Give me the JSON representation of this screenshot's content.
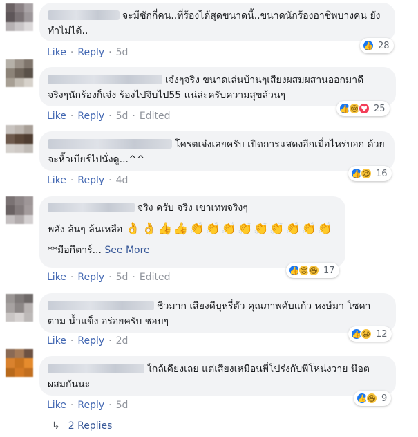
{
  "comments": [
    {
      "text": "จะมีซักกี่คน..ที่ร้องได้สุดขนาดนี้..ขนาดนักร้องอาชีพบางคน ยังทำไม่ได้..",
      "reaction_count": "28",
      "reactions": [
        "like-icon"
      ],
      "actions": {
        "like": "Like",
        "reply": "Reply",
        "time": "5d",
        "edited": ""
      },
      "avatar_colors": [
        "#6b6264",
        "#8a8184",
        "#a9a3a6",
        "#5e5659",
        "#7a7275",
        "#9d979a",
        "#b6b1b3",
        "#c9c5c7",
        "#dcd9da"
      ]
    },
    {
      "text": "เจ๋งๆจริง ขนาดเล่นบ้านๆเสียงผสมผสานออกมาดี จริงๆนักร้องก็เจ๋ง ร้องไปจิบไป55 แน่ล่ะครับความสุขล้วนๆ",
      "reaction_count": "25",
      "reactions": [
        "like-icon",
        "sad-icon",
        "love-icon"
      ],
      "actions": {
        "like": "Like",
        "reply": "Reply",
        "time": "5d",
        "edited": "Edited"
      },
      "avatar_colors": [
        "#b5b0a8",
        "#9a9188",
        "#7f756c",
        "#8c8378",
        "#6f655b",
        "#5a5149",
        "#a79f94",
        "#c3bdb4",
        "#d7d2cb"
      ]
    },
    {
      "text": "โครตเจ๋งเลยครับ เปิดการแสดงอีกเมื่อไหร่บอก ด้วย จะหิ้วเบียร์ไปนั่งดู...^^",
      "reaction_count": "16",
      "reactions": [
        "like-icon",
        "haha-icon"
      ],
      "actions": {
        "like": "Like",
        "reply": "Reply",
        "time": "4d",
        "edited": ""
      },
      "avatar_colors": [
        "#c8c3bf",
        "#bdb6b0",
        "#a89f97",
        "#6e5a4d",
        "#5b4739",
        "#4f3d31",
        "#d4d0cc",
        "#cfcac6",
        "#c1bcb7"
      ]
    },
    {
      "text": "จริง ครับ จริง เขาเทพจริงๆ",
      "text2": "พลัง ล้นๆ ล้นเหลือ",
      "emojis": [
        "👌",
        "👌",
        "👍",
        "👍",
        "👏",
        "👏",
        "👏",
        "👏",
        "👏",
        "👏",
        "👏",
        "👏",
        "👏"
      ],
      "text3": "**มือกีตาร์...",
      "see_more": "See More",
      "reaction_count": "17",
      "reactions": [
        "like-icon",
        "sad-icon",
        "haha-icon"
      ],
      "actions": {
        "like": "Like",
        "reply": "Reply",
        "time": "5d",
        "edited": "Edited"
      },
      "avatar_colors": [
        "#7a7273",
        "#8d8586",
        "#9e9697",
        "#6a6263",
        "#837b7c",
        "#a39b9c",
        "#c4bfc0",
        "#b2acad",
        "#d3cfd0"
      ]
    },
    {
      "text": "ชิวมาก เสียงดีบุหรี่ตัว คุณภาพคับแก้ว หงษ์มา โซดาตาม น้ำแข็ง อร่อยครับ ชอบๆ",
      "reaction_count": "12",
      "reactions": [
        "like-icon",
        "haha-icon"
      ],
      "actions": {
        "like": "Like",
        "reply": "Reply",
        "time": "2d",
        "edited": ""
      },
      "avatar_colors": [
        "#9a9594",
        "#7f7a79",
        "#6e6968",
        "#a7a2a1",
        "#8c8786",
        "#b9b4b3",
        "#c9c5c4",
        "#d6d2d1",
        "#bdb9b8"
      ]
    },
    {
      "text": "ใกล้เคียงเลย แต่เสียงเหมือนพี่โปร่งกับพี่โหน่งวาย น๊อตผสมกันนะ",
      "reaction_count": "9",
      "reactions": [
        "like-icon",
        "haha-icon"
      ],
      "actions": {
        "like": "Like",
        "reply": "Reply",
        "time": "5d",
        "edited": ""
      },
      "avatar_colors": [
        "#8a6a55",
        "#a47a58",
        "#6d5243",
        "#d9822e",
        "#c9741f",
        "#e58b2d",
        "#b86a1c",
        "#d47a24",
        "#c26f20"
      ]
    }
  ],
  "replies_link": "2 Replies",
  "colors": {
    "link": "#4267b2",
    "meta": "#90949c",
    "bubble": "#f2f3f5",
    "like": "#1877f2"
  }
}
